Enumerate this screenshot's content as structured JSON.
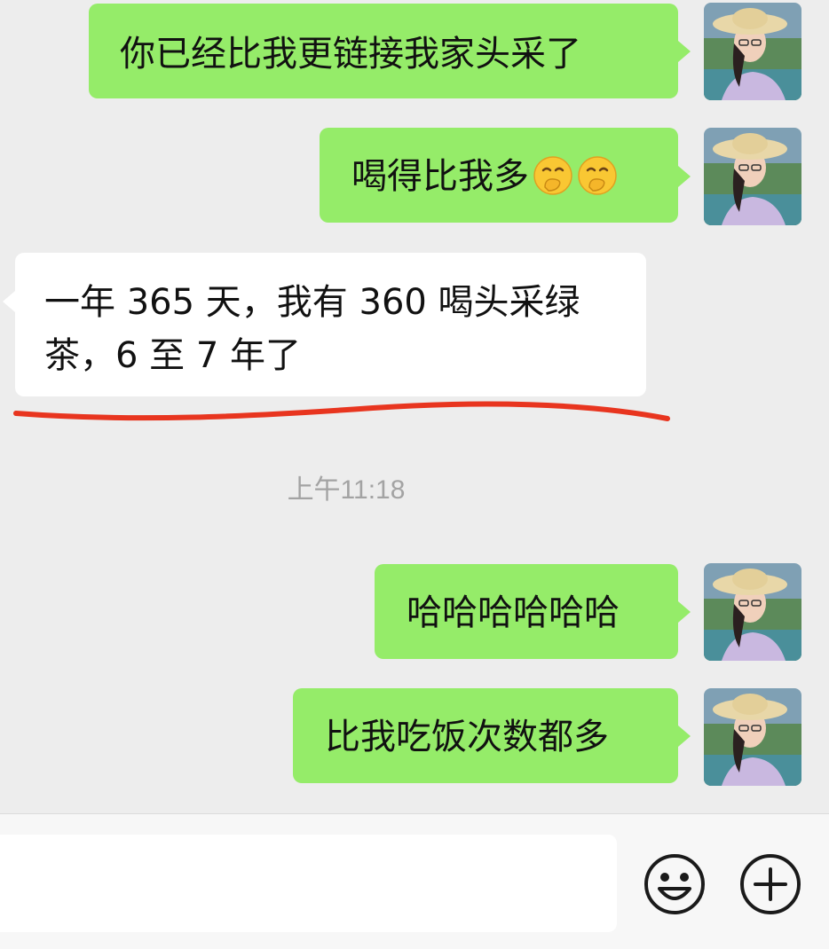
{
  "messages": [
    {
      "side": "out",
      "text": "你已经比我更链接我家头采了"
    },
    {
      "side": "out",
      "text": "喝得比我多",
      "emoji": [
        "hand-over-mouth-emoji",
        "hand-over-mouth-emoji"
      ]
    },
    {
      "side": "in",
      "text": "一年 365 天，我有 360 喝头采绿茶，6 至 7 年了"
    },
    {
      "side": "out",
      "text": "哈哈哈哈哈哈"
    },
    {
      "side": "out",
      "text": "比我吃饭次数都多"
    }
  ],
  "timestamp": "上午11:18",
  "annotation_color": "#e8351f",
  "colors": {
    "outgoing_bubble": "#95ec69",
    "incoming_bubble": "#ffffff",
    "background": "#ededed"
  },
  "input_bar": {
    "emoji_button_icon": "smiley-face-icon",
    "more_button_icon": "plus-circle-icon"
  }
}
